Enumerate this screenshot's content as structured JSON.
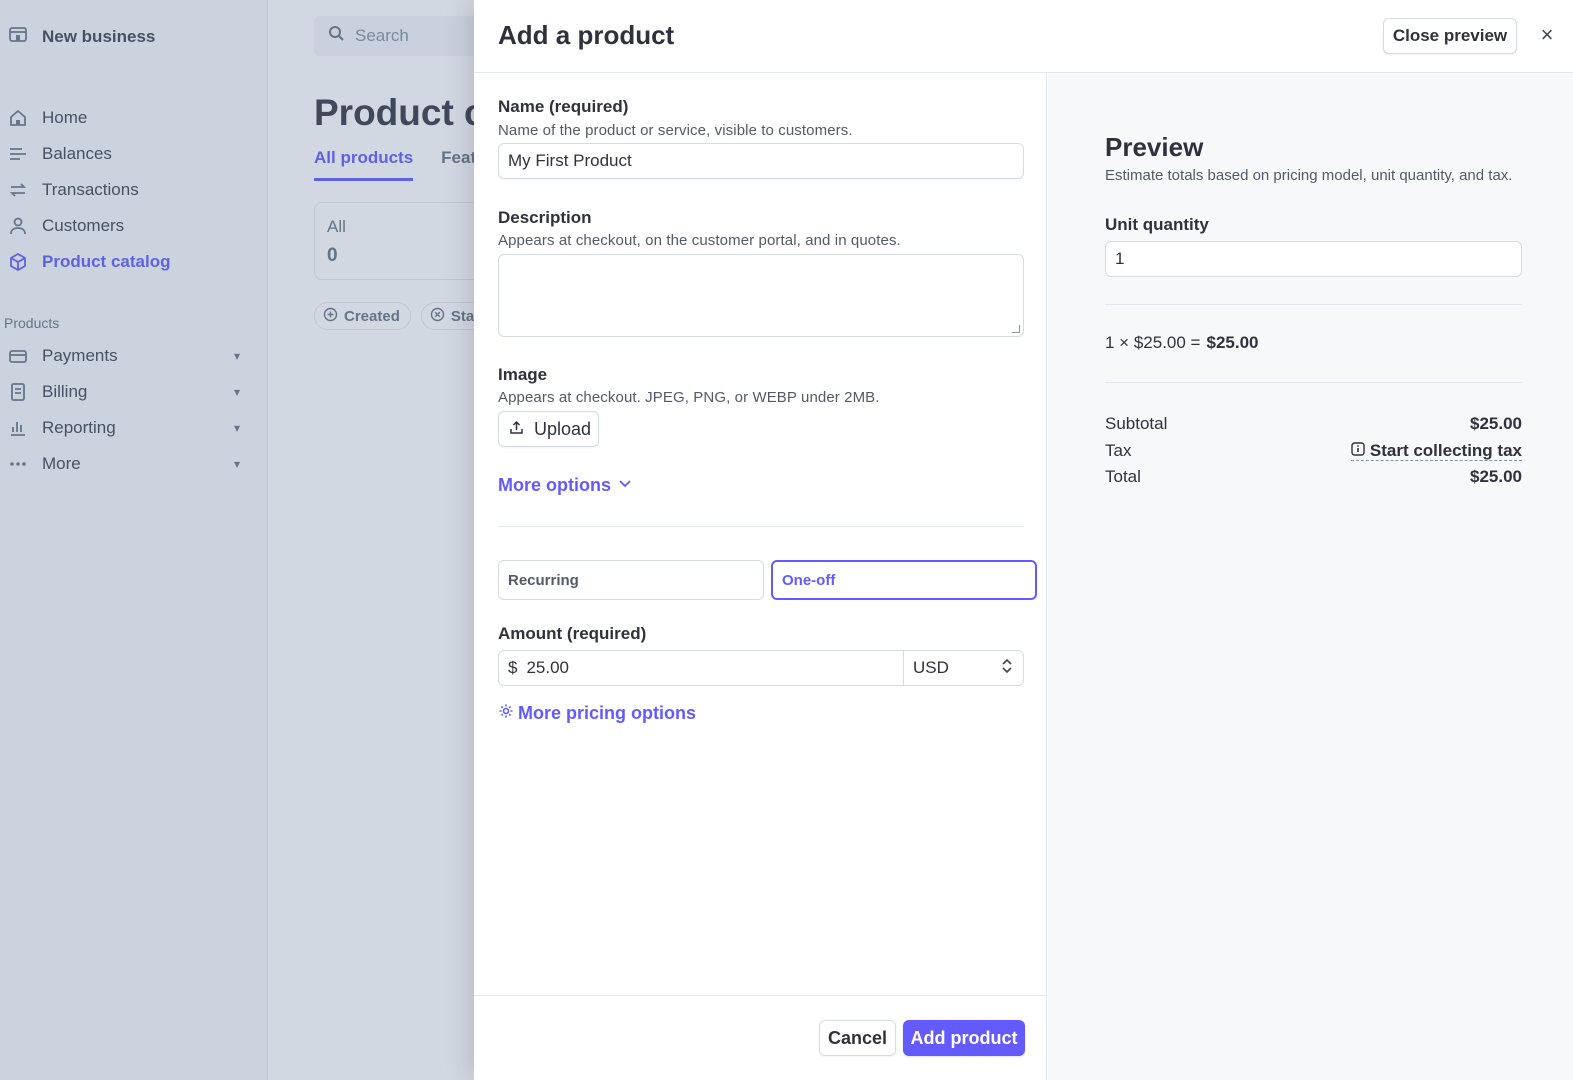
{
  "sidebar": {
    "business_name": "New business",
    "nav": [
      {
        "label": "Home",
        "icon": "home-icon"
      },
      {
        "label": "Balances",
        "icon": "balances-icon"
      },
      {
        "label": "Transactions",
        "icon": "transactions-icon"
      },
      {
        "label": "Customers",
        "icon": "customers-icon"
      },
      {
        "label": "Product catalog",
        "icon": "product-catalog-icon",
        "active": true
      }
    ],
    "section_label": "Products",
    "products_nav": [
      {
        "label": "Payments",
        "icon": "payments-icon"
      },
      {
        "label": "Billing",
        "icon": "billing-icon"
      },
      {
        "label": "Reporting",
        "icon": "reporting-icon"
      },
      {
        "label": "More",
        "icon": "more-icon"
      }
    ]
  },
  "main": {
    "search_placeholder": "Search",
    "page_title": "Product ca",
    "tabs": [
      {
        "label": "All products",
        "active": true
      },
      {
        "label": "Feat"
      }
    ],
    "stat_card": {
      "label": "All",
      "count": "0"
    },
    "filters": [
      {
        "label": "Created",
        "icon": "plus-circle-icon"
      },
      {
        "label": "Stat",
        "icon": "x-circle-icon"
      }
    ]
  },
  "modal": {
    "title": "Add a product",
    "close_preview_label": "Close preview",
    "close_icon": "×",
    "name": {
      "label": "Name (required)",
      "help": "Name of the product or service, visible to customers.",
      "value": "My First Product"
    },
    "description": {
      "label": "Description",
      "help": "Appears at checkout, on the customer portal, and in quotes.",
      "value": ""
    },
    "image": {
      "label": "Image",
      "help": "Appears at checkout. JPEG, PNG, or WEBP under 2MB.",
      "upload_label": "Upload"
    },
    "more_options_label": "More options",
    "pricing_type": {
      "options": [
        "Recurring",
        "One-off"
      ],
      "selected": "One-off"
    },
    "amount": {
      "label": "Amount (required)",
      "currency_symbol": "$",
      "value": "25.00",
      "currency": "USD"
    },
    "more_pricing_label": "More pricing options",
    "cancel_label": "Cancel",
    "add_label": "Add product"
  },
  "preview": {
    "title": "Preview",
    "subtitle": "Estimate totals based on pricing model, unit quantity, and tax.",
    "unit_quantity_label": "Unit quantity",
    "unit_quantity_value": "1",
    "calc_left": "1 × $25.00 =",
    "calc_total": "$25.00",
    "subtotal_label": "Subtotal",
    "subtotal_value": "$25.00",
    "tax_label": "Tax",
    "tax_link": "Start collecting tax",
    "total_label": "Total",
    "total_value": "$25.00"
  },
  "colors": {
    "accent": "#635bff",
    "text": "#30313d",
    "muted": "#6a7383",
    "border": "#d5dbe1"
  }
}
